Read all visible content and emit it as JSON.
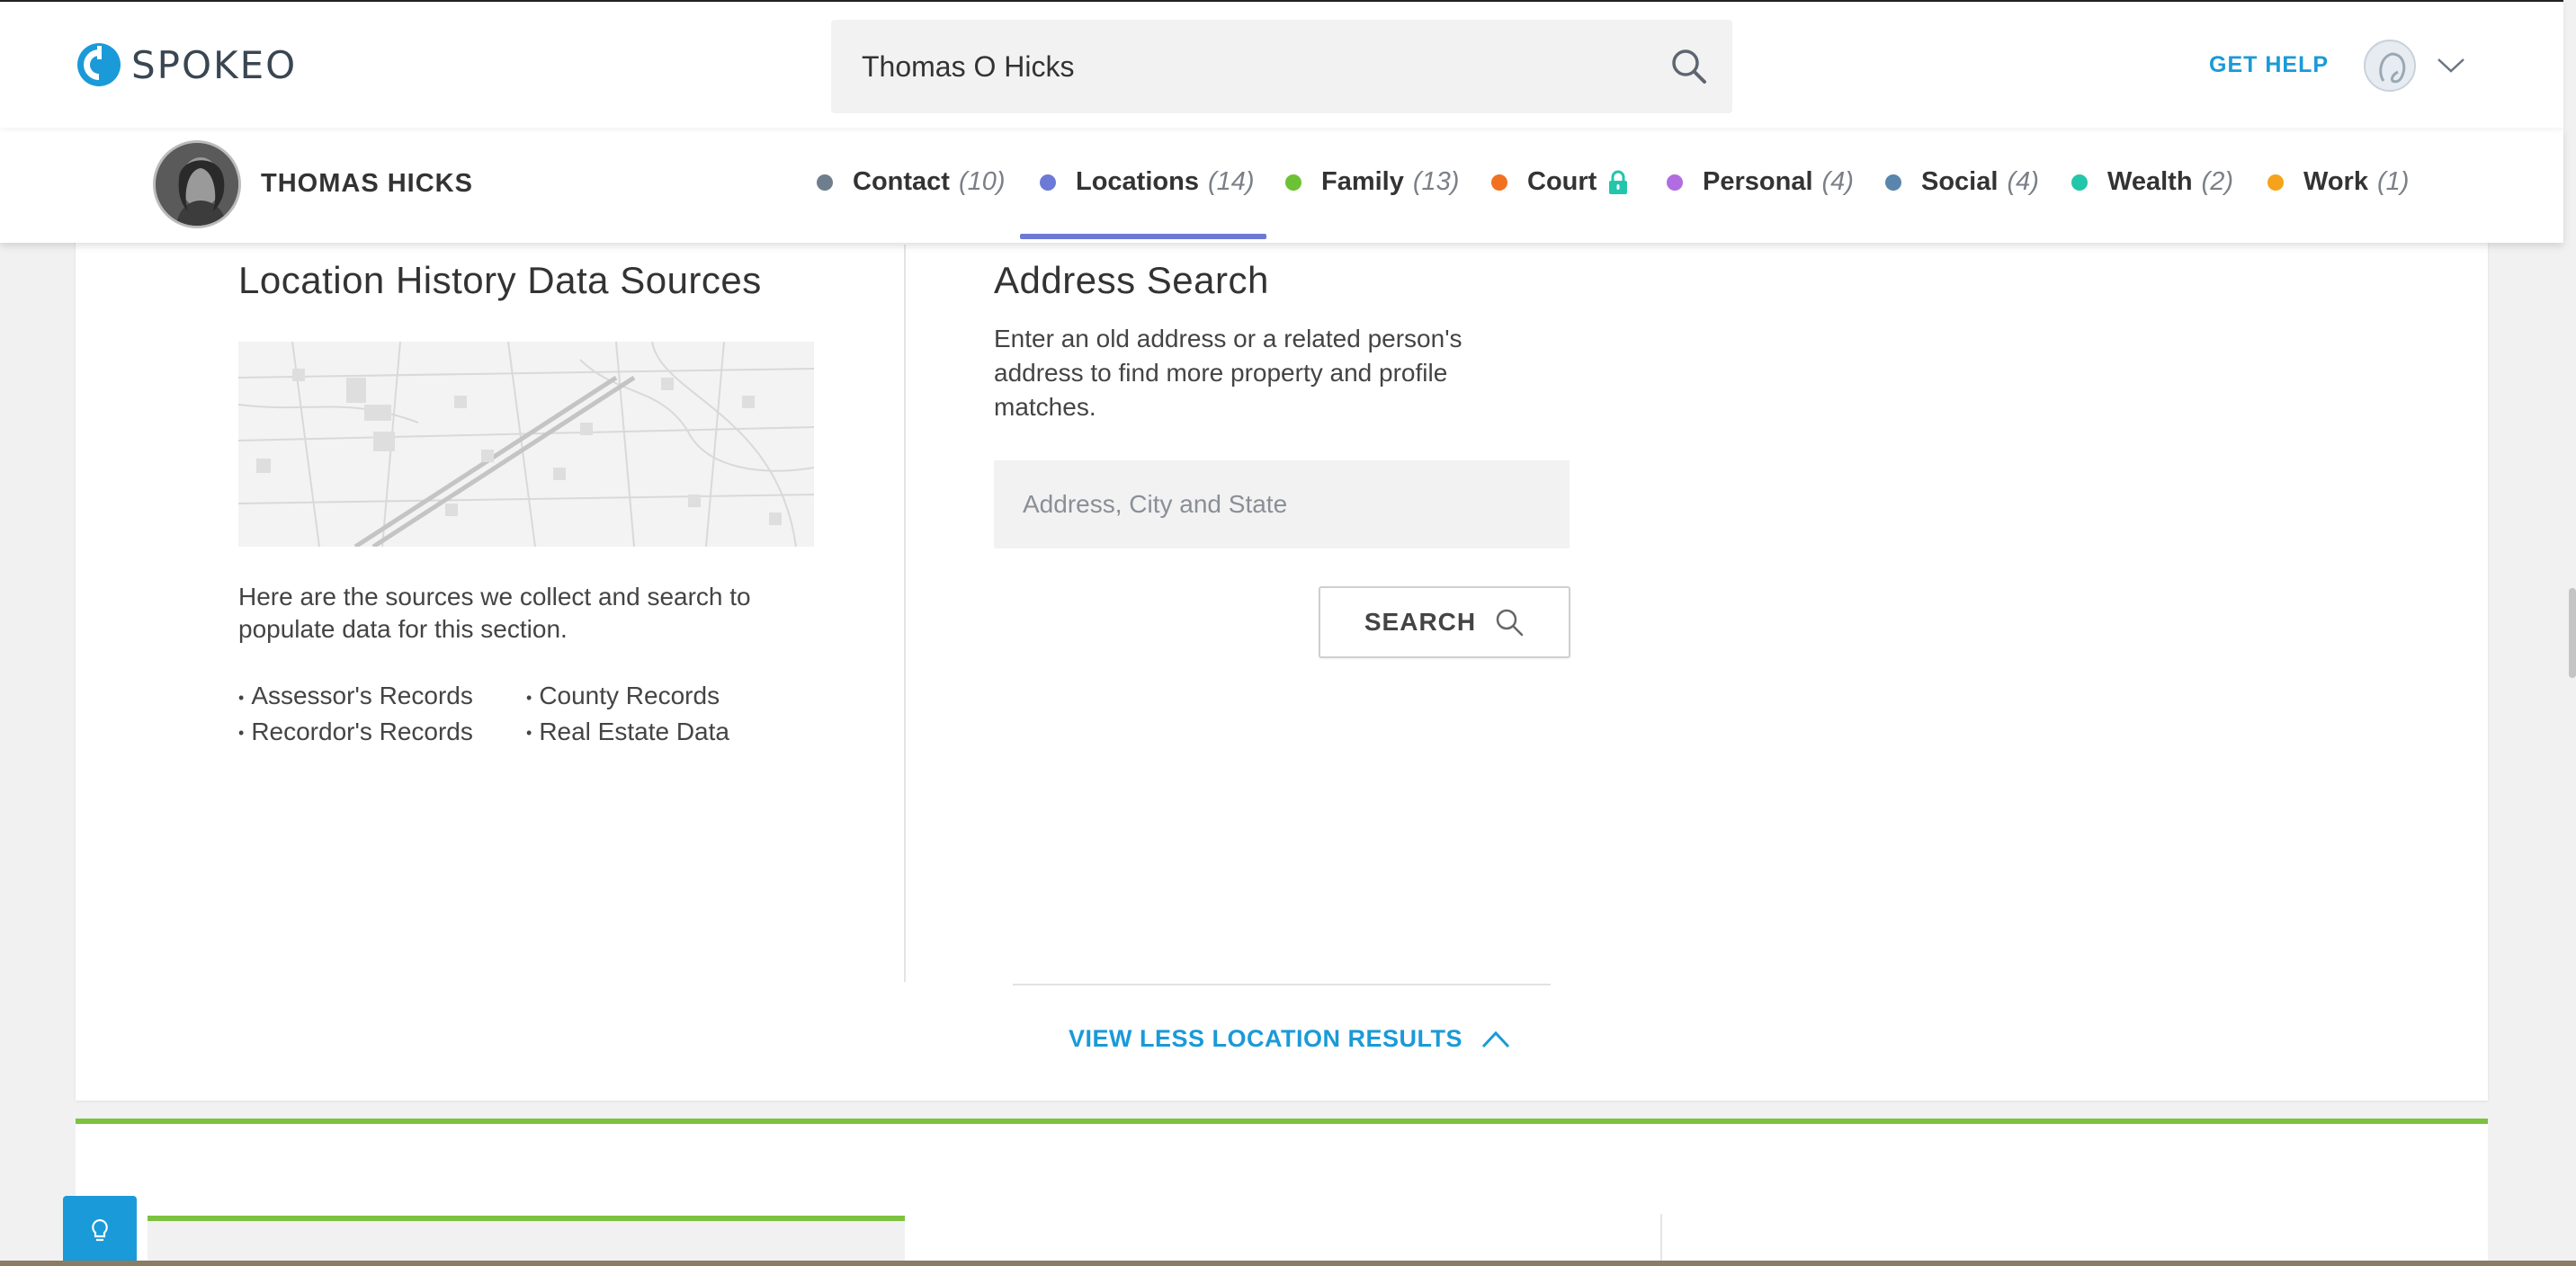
{
  "brand": {
    "name": "SPOKEO",
    "accent": "#1a9ad8"
  },
  "header": {
    "search_value": "Thomas O Hicks",
    "get_help": "GET HELP"
  },
  "profile": {
    "name": "THOMAS HICKS",
    "tabs": [
      {
        "label": "Contact",
        "count": "(10)",
        "dot": "#6e7e8c"
      },
      {
        "label": "Locations",
        "count": "(14)",
        "dot": "#6c79d6",
        "active": true
      },
      {
        "label": "Family",
        "count": "(13)",
        "dot": "#6cc234"
      },
      {
        "label": "Court",
        "count": "",
        "dot": "#f27121",
        "locked": true
      },
      {
        "label": "Personal",
        "count": "(4)",
        "dot": "#b06ce0"
      },
      {
        "label": "Social",
        "count": "(4)",
        "dot": "#5a86ad"
      },
      {
        "label": "Wealth",
        "count": "(2)",
        "dot": "#22c6ab"
      },
      {
        "label": "Work",
        "count": "(1)",
        "dot": "#f5a31a"
      }
    ]
  },
  "location_sources": {
    "title": "Location History Data Sources",
    "description": "Here are the sources we collect and search to populate data for this section.",
    "sources": [
      "Assessor's Records",
      "County Records",
      "Recordor's Records",
      "Real Estate Data"
    ]
  },
  "address_search": {
    "title": "Address Search",
    "description": "Enter an old address or a related person's address to find more property and profile matches.",
    "placeholder": "Address, City and State",
    "button_label": "SEARCH"
  },
  "footer_link": {
    "label": "VIEW LESS LOCATION RESULTS"
  }
}
